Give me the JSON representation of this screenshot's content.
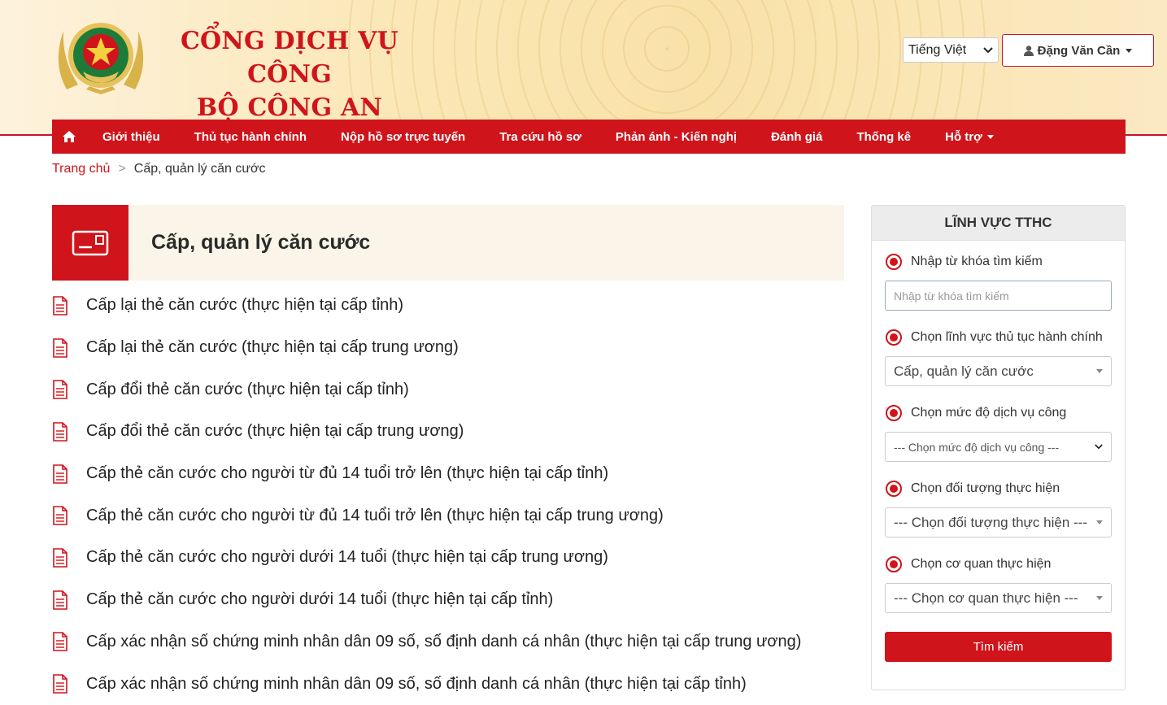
{
  "header": {
    "title_line1": "CỔNG DỊCH VỤ CÔNG",
    "title_line2": "BỘ CÔNG AN",
    "language": "Tiếng Việt",
    "user_name": "Đặng Văn Cần"
  },
  "nav": {
    "items": [
      "Giới thiệu",
      "Thủ tục hành chính",
      "Nộp hồ sơ trực tuyến",
      "Tra cứu hồ sơ",
      "Phản ánh - Kiến nghị",
      "Đánh giá",
      "Thống kê",
      "Hỗ trợ"
    ]
  },
  "breadcrumb": {
    "home": "Trang chủ",
    "separator": ">",
    "current": "Cấp, quản lý căn cước"
  },
  "section": {
    "title": "Cấp, quản lý căn cước"
  },
  "procedures": [
    "Cấp lại thẻ căn cước (thực hiện tại cấp tỉnh)",
    "Cấp lại thẻ căn cước (thực hiện tại cấp trung ương)",
    "Cấp đổi thẻ căn cước (thực hiện tại cấp tỉnh)",
    "Cấp đổi thẻ căn cước (thực hiện tại cấp trung ương)",
    "Cấp thẻ căn cước cho người từ đủ 14 tuổi trở lên (thực hiện tại cấp tỉnh)",
    "Cấp thẻ căn cước cho người từ đủ 14 tuổi trở lên (thực hiện tại cấp trung ương)",
    "Cấp thẻ căn cước cho người dưới 14 tuổi (thực hiện tại cấp trung ương)",
    "Cấp thẻ căn cước cho người dưới 14 tuổi (thực hiện tại cấp tỉnh)",
    "Cấp xác nhận số chứng minh nhân dân 09 số, số định danh cá nhân (thực hiện tại cấp trung ương)",
    "Cấp xác nhận số chứng minh nhân dân 09 số, số định danh cá nhân (thực hiện tại cấp tỉnh)"
  ],
  "sidebar": {
    "title": "LĨNH VỰC TTHC",
    "keyword_label": "Nhập từ khóa tìm kiếm",
    "keyword_placeholder": "Nhập từ khóa tìm kiếm",
    "field_label": "Chọn lĩnh vực thủ tục hành chính",
    "field_value": "Cấp, quản lý căn cước",
    "level_label": "Chọn mức độ dịch vụ công",
    "level_value": "--- Chọn mức độ dịch vụ công ---",
    "subject_label": "Chọn đối tượng thực hiện",
    "subject_value": "--- Chọn đối tượng thực hiện ---",
    "agency_label": "Chọn cơ quan thực hiện",
    "agency_value": "--- Chọn cơ quan thực hiện ---",
    "search_button": "Tìm kiếm"
  },
  "colors": {
    "brand_red": "#d0141b",
    "header_gold": "#fbe7b6",
    "section_bg": "#faf5e8"
  }
}
